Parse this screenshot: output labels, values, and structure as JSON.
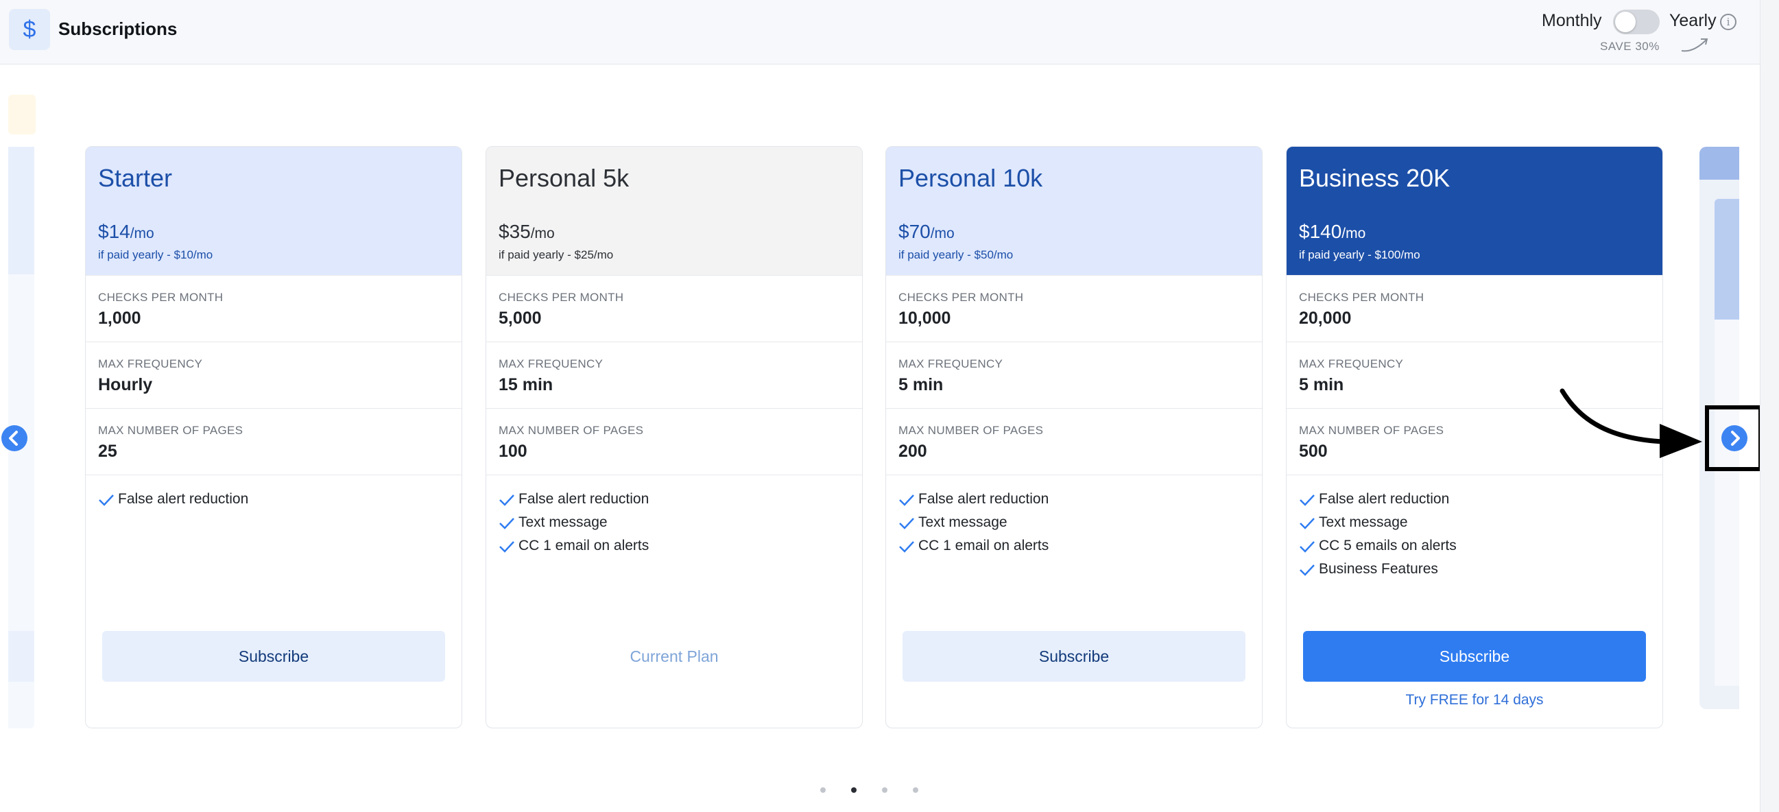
{
  "header": {
    "icon_glyph": "$",
    "title": "Subscriptions",
    "billing": {
      "monthly_label": "Monthly",
      "yearly_label": "Yearly",
      "save_text": "SAVE 30%",
      "yearly_enabled": false
    }
  },
  "plans": [
    {
      "name": "Starter",
      "price": "$14",
      "per": "/mo",
      "yearly_note": "if paid yearly - $10/mo",
      "specs": [
        {
          "label": "CHECKS PER MONTH",
          "value": "1,000"
        },
        {
          "label": "MAX FREQUENCY",
          "value": "Hourly"
        },
        {
          "label": "MAX NUMBER OF PAGES",
          "value": "25"
        }
      ],
      "features": [
        "False alert reduction"
      ],
      "button": "Subscribe"
    },
    {
      "name": "Personal 5k",
      "price": "$35",
      "per": "/mo",
      "yearly_note": "if paid yearly - $25/mo",
      "specs": [
        {
          "label": "CHECKS PER MONTH",
          "value": "5,000"
        },
        {
          "label": "MAX FREQUENCY",
          "value": "15 min"
        },
        {
          "label": "MAX NUMBER OF PAGES",
          "value": "100"
        }
      ],
      "features": [
        "False alert reduction",
        "Text message",
        "CC 1 email on alerts"
      ],
      "button": "Current Plan"
    },
    {
      "name": "Personal 10k",
      "price": "$70",
      "per": "/mo",
      "yearly_note": "if paid yearly - $50/mo",
      "specs": [
        {
          "label": "CHECKS PER MONTH",
          "value": "10,000"
        },
        {
          "label": "MAX FREQUENCY",
          "value": "5 min"
        },
        {
          "label": "MAX NUMBER OF PAGES",
          "value": "200"
        }
      ],
      "features": [
        "False alert reduction",
        "Text message",
        "CC 1 email on alerts"
      ],
      "button": "Subscribe"
    },
    {
      "name": "Business 20K",
      "price": "$140",
      "per": "/mo",
      "yearly_note": "if paid yearly - $100/mo",
      "specs": [
        {
          "label": "CHECKS PER MONTH",
          "value": "20,000"
        },
        {
          "label": "MAX FREQUENCY",
          "value": "5 min"
        },
        {
          "label": "MAX NUMBER OF PAGES",
          "value": "500"
        }
      ],
      "features": [
        "False alert reduction",
        "Text message",
        "CC 5 emails on alerts",
        "Business Features"
      ],
      "button": "Subscribe",
      "trial_link": "Try FREE for 14 days"
    }
  ],
  "carousel": {
    "page_count": 4,
    "active_page": 2
  },
  "colors": {
    "accent": "#2f7cf1",
    "brand_dark": "#1c4fa8",
    "brand_light": "#dfe8fd"
  }
}
